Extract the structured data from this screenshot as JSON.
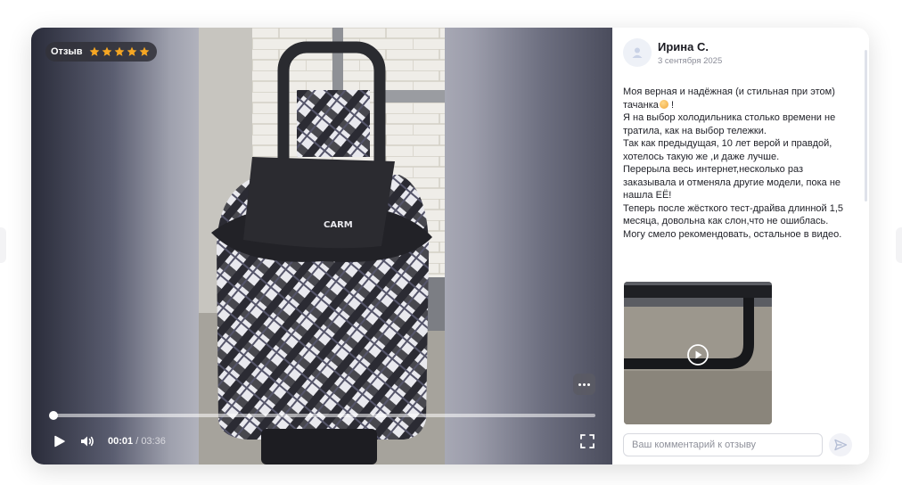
{
  "video": {
    "badge_label": "Отзыв",
    "rating": 5,
    "rating_max": 5,
    "star_color": "#f5a623",
    "progress_fraction": 0.005,
    "time_current": "00:01",
    "time_separator": " / ",
    "time_total": "03:36",
    "icons": [
      "star-icon",
      "more-icon",
      "play-icon",
      "volume-icon",
      "fullscreen-icon"
    ]
  },
  "review": {
    "author_name": "Ирина С.",
    "date": "3 сентября 2025",
    "lines": [
      "Моя верная и надёжная (и стильная при этом) тачанка",
      "Я на выбор холодильника столько времени не тратила, как на выбор тележки.",
      "Так как предыдущая, 10 лет верой и правдой, хотелось такую же ,и даже лучше.",
      "Перерыла весь интернет,несколько раз заказывала и отменяла другие модели, пока не нашла ЕЁ!",
      "Теперь после жёсткого тест-драйва длинной 1,5 месяца, довольна как слон,что не ошиблась.",
      "Могу смело рекомендовать, остальное в видео."
    ],
    "line1_suffix": "!"
  },
  "comment": {
    "placeholder": "Ваш комментарий к отзыву"
  },
  "colors": {
    "accent": "#f5a623",
    "text": "#22232a",
    "muted": "#8a8c97"
  }
}
